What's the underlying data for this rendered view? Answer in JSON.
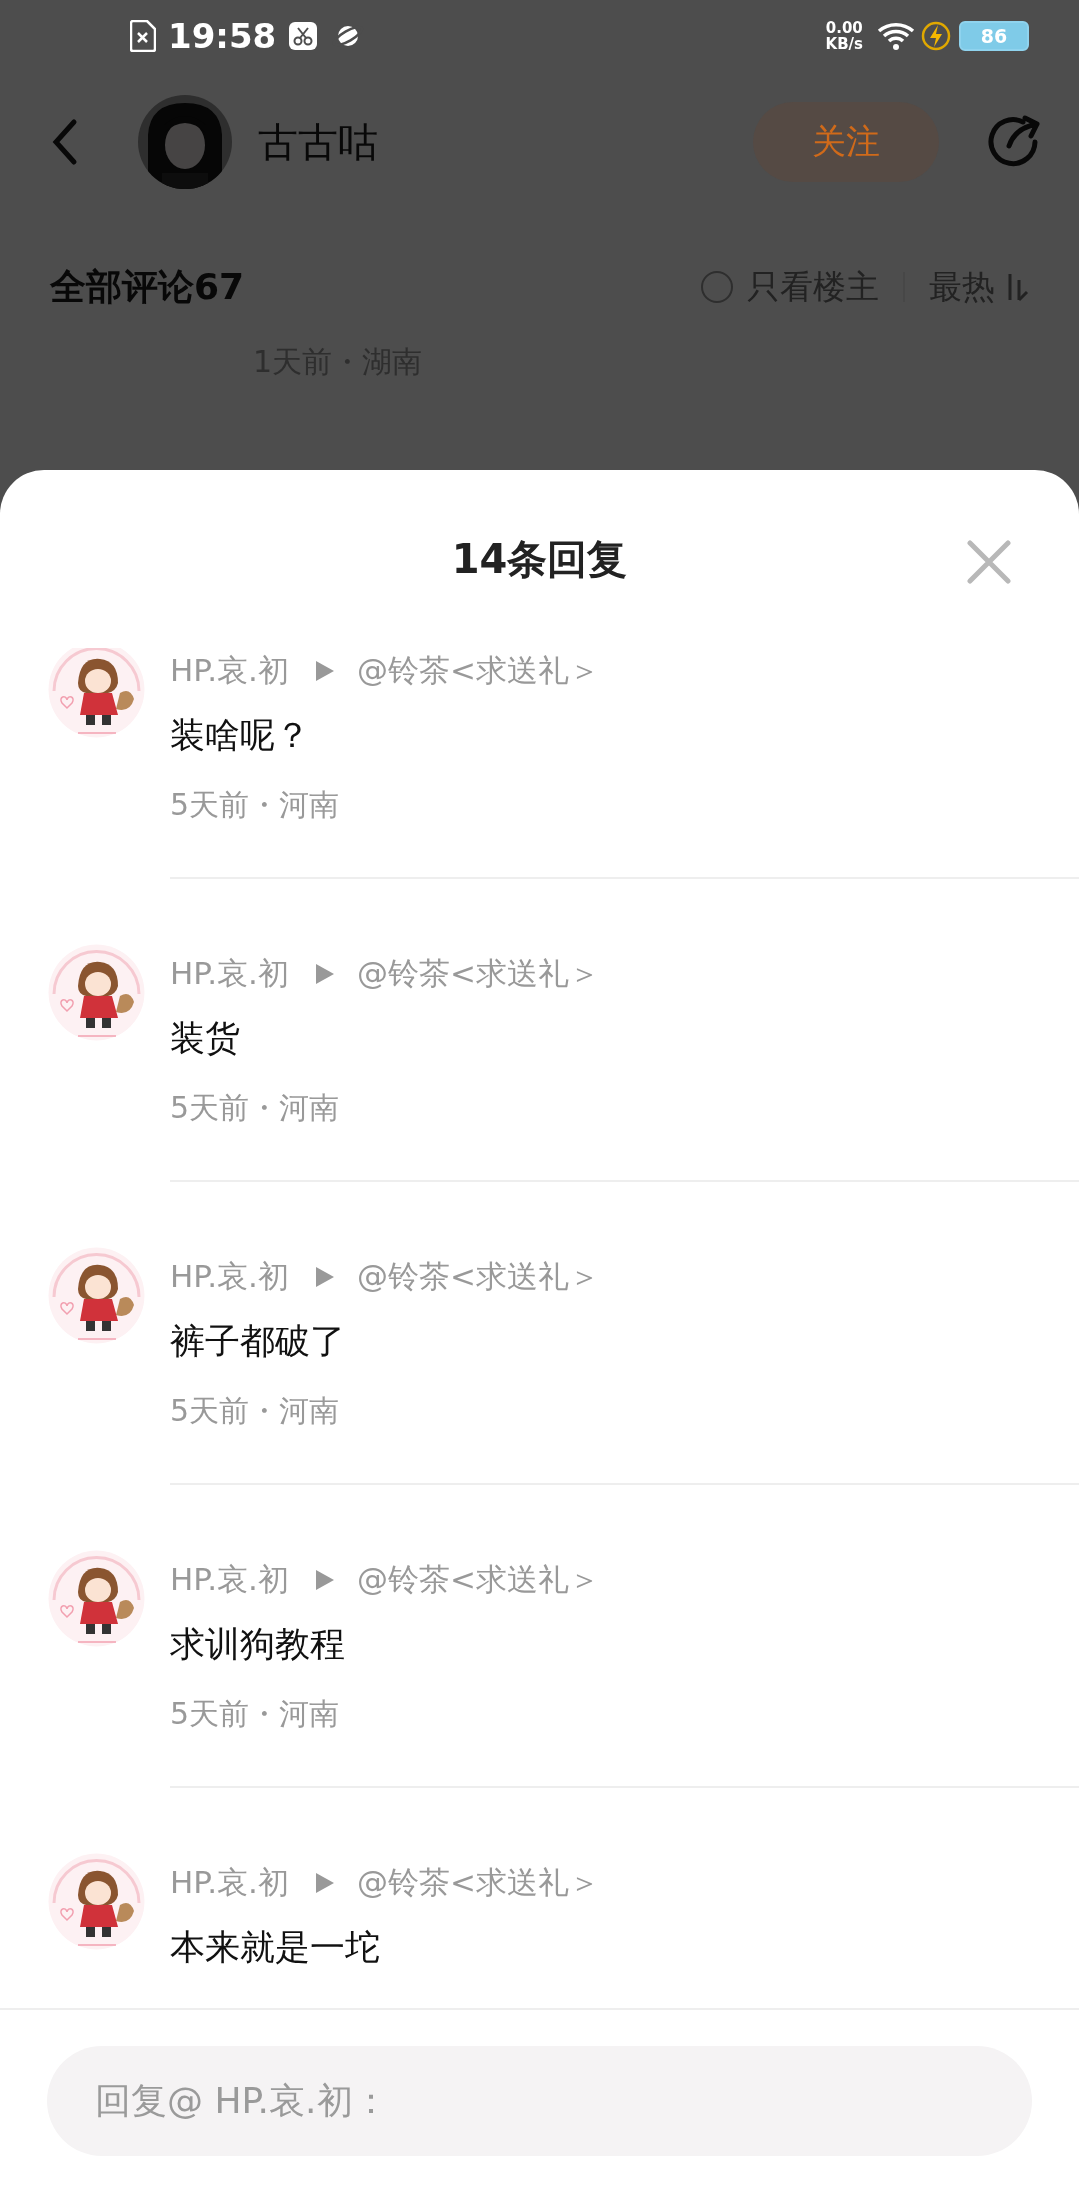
{
  "status_bar": {
    "time": "19:58",
    "net_speed": "0.00",
    "net_unit": "KB/s",
    "battery": "86"
  },
  "header": {
    "username": "古古咕",
    "follow_button": "关注"
  },
  "comments_bar": {
    "title": "全部评论67",
    "only_op": {
      "label": "只看楼主",
      "checked": false
    },
    "sort": "最热"
  },
  "background_comment": {
    "meta": "1天前・湖南"
  },
  "sheet": {
    "title": "14条回复",
    "replies": [
      {
        "author": "HP.哀.初",
        "target": "@铃茶<求送礼＞",
        "text": "装啥呢？",
        "meta": "5天前・河南"
      },
      {
        "author": "HP.哀.初",
        "target": "@铃茶<求送礼＞",
        "text": "装货",
        "meta": "5天前・河南"
      },
      {
        "author": "HP.哀.初",
        "target": "@铃茶<求送礼＞",
        "text": "裤子都破了",
        "meta": "5天前・河南"
      },
      {
        "author": "HP.哀.初",
        "target": "@铃茶<求送礼＞",
        "text": "求训狗教程",
        "meta": "5天前・河南"
      },
      {
        "author": "HP.哀.初",
        "target": "@铃茶<求送礼＞",
        "text": "本来就是一坨"
      }
    ]
  },
  "reply_field": {
    "placeholder": "回复@ HP.哀.初："
  }
}
